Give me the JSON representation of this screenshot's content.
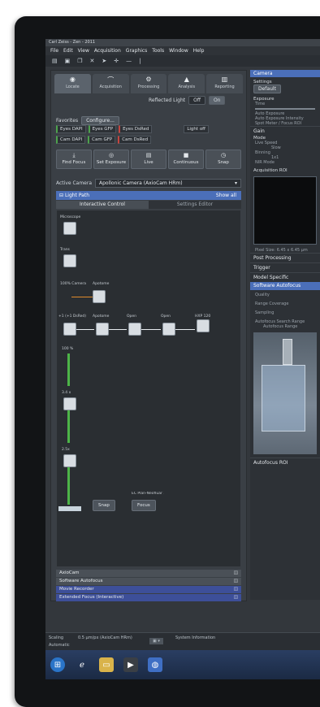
{
  "window": {
    "title": "Carl Zeiss - Zen - 2011"
  },
  "menu": [
    "File",
    "Edit",
    "View",
    "Acquisition",
    "Graphics",
    "Tools",
    "Window",
    "Help"
  ],
  "main_tabs": [
    {
      "label": "Locate",
      "icon": "eye-icon",
      "active": true
    },
    {
      "label": "Acquisition",
      "icon": "acquisition-icon",
      "active": false
    },
    {
      "label": "Processing",
      "icon": "processing-icon",
      "active": false
    },
    {
      "label": "Analysis",
      "icon": "analysis-icon",
      "active": false
    },
    {
      "label": "Reporting",
      "icon": "reporting-icon",
      "active": false
    }
  ],
  "reflected_light": {
    "label": "Reflected Light",
    "off": "Off",
    "on": "On"
  },
  "favorites": {
    "label": "Favorites",
    "configure": "Configure..."
  },
  "favorite_buttons": [
    [
      "Eyes DAPI",
      "Eyes GFP",
      "Eyes DsRed",
      "Light off"
    ],
    [
      "Cam DAPI",
      "Cam GFP",
      "Cam DsRed"
    ]
  ],
  "actions": [
    {
      "label": "Find Focus",
      "icon": "find-focus-icon"
    },
    {
      "label": "Set Exposure",
      "icon": "exposure-icon"
    },
    {
      "label": "Live",
      "icon": "live-icon"
    },
    {
      "label": "Continuous",
      "icon": "continuous-icon"
    },
    {
      "label": "Snap",
      "icon": "snap-icon"
    }
  ],
  "active_camera": {
    "label": "Active Camera",
    "value": "Apollonic Camera (AxioCam HRm)"
  },
  "light_path": {
    "title": "Light Path",
    "show_all": "Show all",
    "tab_interactive": "Interactive Control",
    "tab_settings": "Settings Editor"
  },
  "light_path_labels": {
    "microscope": "Microscope",
    "trans": "Trans",
    "cam": "100% Camera",
    "apotome": "Apotome",
    "filters": [
      "+1 (+1 DsRed)",
      "Apotome",
      "Open",
      "Open",
      "HXP 120"
    ],
    "pct100": "100 %",
    "pct3": "3.4 x",
    "pct2": "2.5x"
  },
  "light_path_buttons": {
    "snap": "Snap",
    "focus_label": "EC Plan-Neofluar 10x/0.3 M27",
    "focus_btn": "Focus"
  },
  "bottom_panels": [
    {
      "label": "AxioCam",
      "style": "grey"
    },
    {
      "label": "Software Autofocus",
      "style": "grey"
    },
    {
      "label": "Movie Recorder",
      "style": "blue"
    },
    {
      "label": "Extended Focus (Interactive)",
      "style": "blue"
    }
  ],
  "right": {
    "camera_title": "Camera",
    "settings": "Settings",
    "default": "Default",
    "exposure": "Exposure",
    "time": "Time",
    "auto_exposure": "Auto Exposure",
    "auto_exposure_intensity": "Auto Exposure Intensity",
    "spot_meter": "Spot Meter / Focus ROI",
    "gain": "Gain",
    "mode": "Mode",
    "live_speed": "Live Speed",
    "live_speed_value": "Slow",
    "binning": "Binning",
    "binning_value": "1x1",
    "nir_mode": "NIR Mode",
    "acq_roi": "Acquisition ROI",
    "pixel_size": "Pixel Size: 6.45 x 6.45 µm",
    "post_processing": "Post Processing",
    "trigger": "Trigger",
    "model_specific": "Model Specific",
    "software_autofocus": "Software Autofocus",
    "quality": "Quality",
    "range_coverage": "Range Coverage",
    "sampling": "Sampling",
    "search_range": "Autofocus Search Range",
    "af_range": "Autofocus Range",
    "autofocus_roi": "Autofocus ROI"
  },
  "status": {
    "scaling_label": "Scaling",
    "scaling_value": "0.5 µm/px (AxioCam HRm)",
    "system_info": "System Information",
    "automatic": "Automatic"
  },
  "taskbar": [
    "start-orb-icon",
    "ie-icon",
    "explorer-icon",
    "media-player-icon",
    "zen-icon"
  ]
}
